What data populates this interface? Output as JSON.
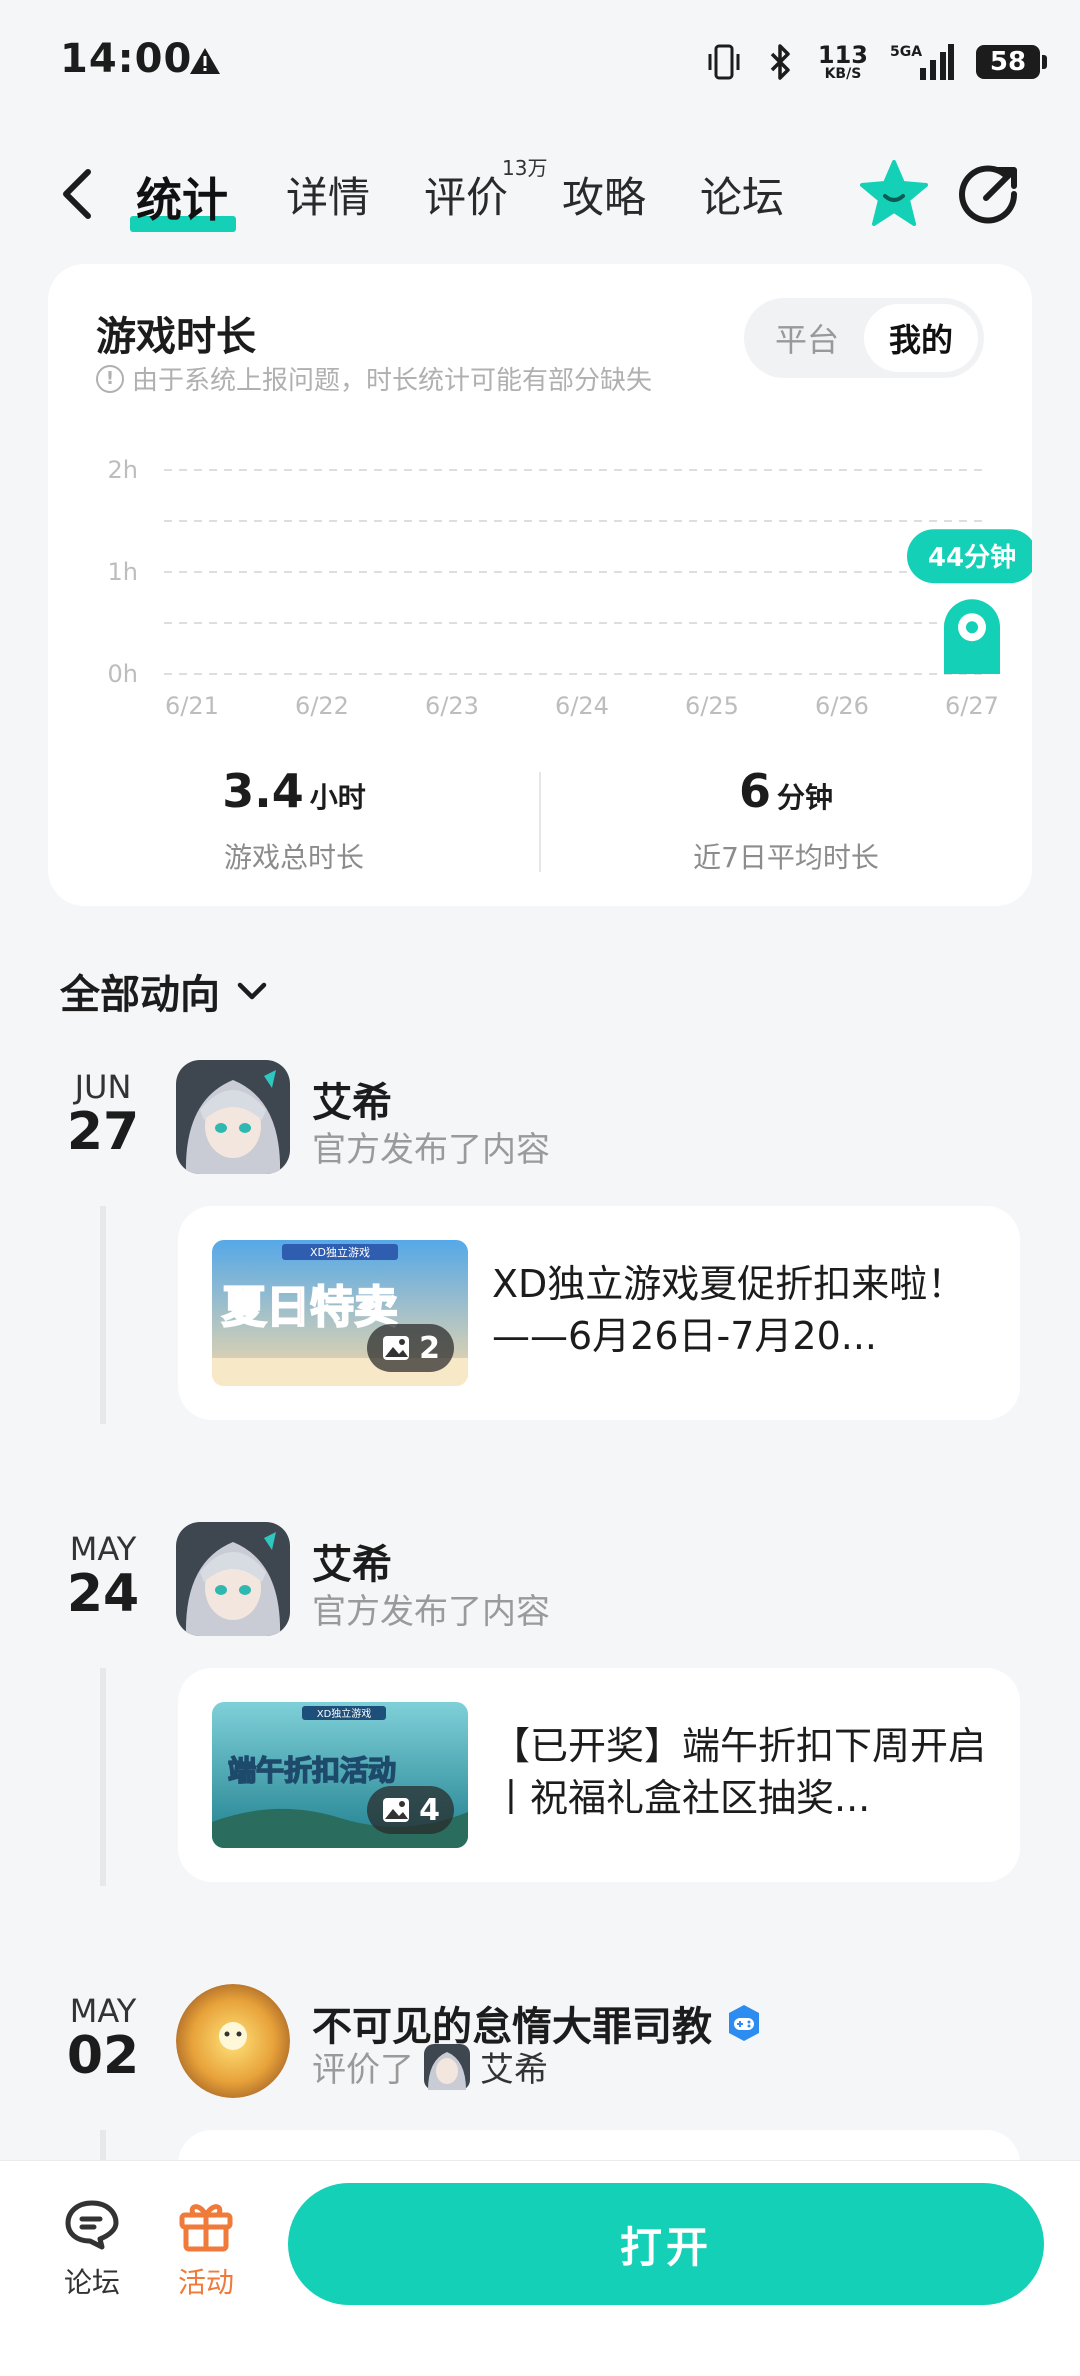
{
  "status_bar": {
    "time": "14:00",
    "net_speed_top": "113",
    "net_speed_bottom": "KB/S",
    "network": "5GA",
    "battery": "58"
  },
  "nav": {
    "tabs": [
      {
        "label": "统计",
        "active": true
      },
      {
        "label": "详情"
      },
      {
        "label": "评价",
        "badge": "13万"
      },
      {
        "label": "攻略"
      },
      {
        "label": "论坛"
      }
    ],
    "icons": [
      "back-icon",
      "star-favorite-icon",
      "share-icon"
    ]
  },
  "stats": {
    "title": "游戏时长",
    "note": "由于系统上报问题，时长统计可能有部分缺失",
    "toggle": {
      "options": [
        "平台",
        "我的"
      ],
      "selected": "我的"
    },
    "summary": [
      {
        "value": "3.4",
        "unit": "小时",
        "label": "游戏总时长"
      },
      {
        "value": "6",
        "unit": "分钟",
        "label": "近7日平均时长"
      }
    ]
  },
  "chart_data": {
    "type": "bar",
    "categories": [
      "6/21",
      "6/22",
      "6/23",
      "6/24",
      "6/25",
      "6/26",
      "6/27"
    ],
    "values_minutes": [
      0,
      0,
      0,
      0,
      0,
      0,
      44
    ],
    "y_ticks": [
      "0h",
      "1h",
      "2h"
    ],
    "ylim_hours": [
      0,
      2
    ],
    "highlight_label": "44分钟",
    "accent_color": "#13d0b6",
    "grid": true
  },
  "feed": {
    "filter_label": "全部动向",
    "items": [
      {
        "month": "JUN",
        "day": "27",
        "name": "艾希",
        "action": "官方发布了内容",
        "post": {
          "title": "XD独立游戏夏促折扣来啦！——6月26日-7月20...",
          "image_count": "2",
          "thumb_caption": "XD独立游戏",
          "thumb_title": "夏日特卖"
        }
      },
      {
        "month": "MAY",
        "day": "24",
        "name": "艾希",
        "action": "官方发布了内容",
        "post": {
          "title": "【已开奖】端午折扣下周开启丨祝福礼盒社区抽奖...",
          "image_count": "4",
          "thumb_caption": "XD独立游戏",
          "thumb_title": "端午折扣活动"
        }
      },
      {
        "month": "MAY",
        "day": "02",
        "name": "不可见的怠惰大罪司教",
        "action": "评价了",
        "target": "艾希"
      }
    ]
  },
  "bottom_bar": {
    "items": [
      {
        "label": "论坛",
        "color": "#333333"
      },
      {
        "label": "活动",
        "color": "#f07a3a"
      }
    ],
    "open_button": "打开"
  }
}
